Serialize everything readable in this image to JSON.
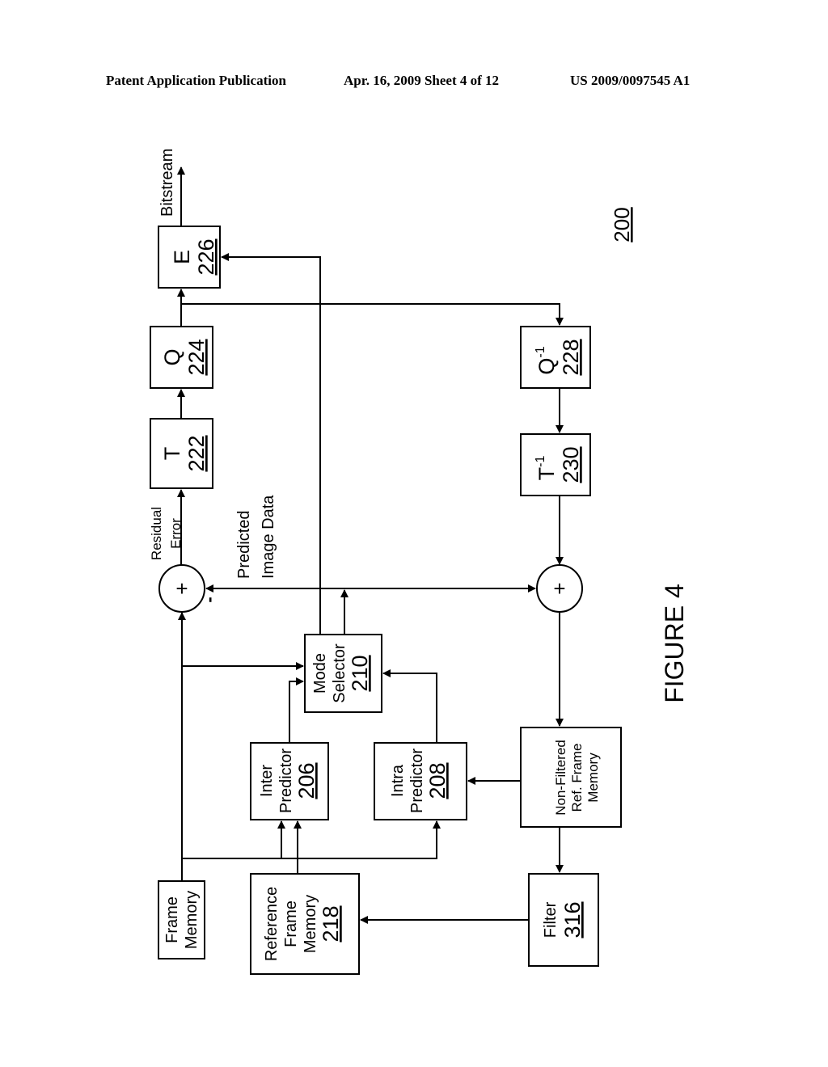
{
  "header": {
    "publication": "Patent Application Publication",
    "date_sheet": "Apr. 16, 2009  Sheet 4 of 12",
    "patent_number": "US 2009/0097545 A1"
  },
  "figure": {
    "title": "FIGURE 4",
    "reference_number": "200"
  },
  "blocks": {
    "encoder": {
      "name": "E",
      "ref": "226"
    },
    "quantizer": {
      "name": "Q",
      "ref": "224"
    },
    "transform": {
      "name": "T",
      "ref": "222"
    },
    "inverse_quantizer": {
      "name": "Q",
      "superscript": "-1",
      "ref": "228"
    },
    "inverse_transform": {
      "name": "T",
      "superscript": "-1",
      "ref": "230"
    },
    "mode_selector": {
      "line1": "Mode",
      "line2": "Selector",
      "ref": "210"
    },
    "inter_predictor": {
      "line1": "Inter",
      "line2": "Predictor",
      "ref": "206"
    },
    "intra_predictor": {
      "line1": "Intra",
      "line2": "Predictor",
      "ref": "208"
    },
    "non_filtered_memory": {
      "line1": "Non-Filtered",
      "line2": "Ref. Frame",
      "line3": "Memory"
    },
    "frame_memory": {
      "line1": "Frame",
      "line2": "Memory"
    },
    "reference_frame_memory": {
      "line1": "Reference",
      "line2": "Frame",
      "line3": "Memory",
      "ref": "218"
    },
    "filter": {
      "name": "Filter",
      "ref": "316"
    }
  },
  "summers": {
    "residual_summer": {
      "symbol": "+",
      "minus_sign": "-"
    },
    "reconstruction_summer": {
      "symbol": "+"
    }
  },
  "labels": {
    "bitstream": "Bitstream",
    "residual_line1": "Residual",
    "residual_line2": "Error",
    "predicted_line1": "Predicted",
    "predicted_line2": "Image Data"
  }
}
